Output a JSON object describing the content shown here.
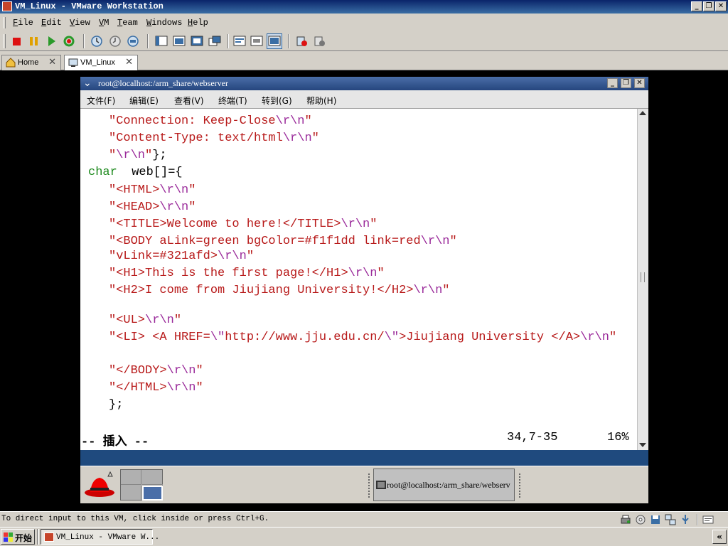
{
  "window": {
    "title": "VM_Linux - VMware Workstation"
  },
  "menu": [
    "File",
    "Edit",
    "View",
    "VM",
    "Team",
    "Windows",
    "Help"
  ],
  "toolbar": {
    "icons": [
      "stop-icon",
      "pause-icon",
      "play-icon",
      "reset-icon",
      "snapshot-icon",
      "revert-snapshot-icon",
      "snapshot-manager-icon",
      "normal-view-icon",
      "quick-switch-icon",
      "full-screen-icon",
      "summary-view-icon",
      "console-view-icon",
      "appliance-view-icon",
      "connect-icon",
      "disconnect-icon"
    ]
  },
  "tabs": [
    {
      "label": "Home",
      "active": false
    },
    {
      "label": "VM_Linux",
      "active": true
    }
  ],
  "guest": {
    "title": "root@localhost:/arm_share/webserver",
    "menu": [
      "文件(F)",
      "编辑(E)",
      "查看(V)",
      "终端(T)",
      "转到(G)",
      "帮助(H)"
    ],
    "mode": "-- 插入 --",
    "position": "34,7-35",
    "percent": "16%",
    "taskbar_item": "root@localhost:/arm_share/webserv"
  },
  "code": [
    {
      "indent": 4,
      "parts": [
        [
          "s",
          "\"Connection: Keep-Close"
        ],
        [
          "e",
          "\\r\\n"
        ],
        [
          "s",
          "\""
        ]
      ]
    },
    {
      "indent": 4,
      "parts": [
        [
          "s",
          "\"Content-Type: text/html"
        ],
        [
          "e",
          "\\r\\n"
        ],
        [
          "s",
          "\""
        ]
      ]
    },
    {
      "indent": 4,
      "parts": [
        [
          "s",
          "\""
        ],
        [
          "e",
          "\\r\\n"
        ],
        [
          "s",
          "\""
        ],
        [
          "p",
          "};"
        ]
      ]
    },
    {
      "indent": 0,
      "parts": [
        [
          "k",
          "char"
        ],
        [
          "p",
          "  web[]={"
        ]
      ]
    },
    {
      "indent": 4,
      "parts": [
        [
          "s",
          "\"<HTML>"
        ],
        [
          "e",
          "\\r\\n"
        ],
        [
          "s",
          "\""
        ]
      ]
    },
    {
      "indent": 4,
      "parts": [
        [
          "s",
          "\"<HEAD>"
        ],
        [
          "e",
          "\\r\\n"
        ],
        [
          "s",
          "\""
        ]
      ]
    },
    {
      "indent": 4,
      "parts": [
        [
          "s",
          "\"<TITLE>Welcome to here!</TITLE>"
        ],
        [
          "e",
          "\\r\\n"
        ],
        [
          "s",
          "\""
        ]
      ]
    },
    {
      "indent": 4,
      "parts": [
        [
          "s",
          "\"<BODY aLink=green bgColor=#f1f1dd link=red"
        ],
        [
          "e",
          "\\r\\n"
        ],
        [
          "s",
          "\""
        ]
      ]
    },
    {
      "indent": 4,
      "parts": [
        [
          "s",
          "\"vLink=#321afd>"
        ],
        [
          "e",
          "\\r\\n"
        ],
        [
          "s",
          "\""
        ]
      ]
    },
    {
      "indent": 4,
      "parts": [
        [
          "s",
          "\"<H1>This is the first page!</H1>"
        ],
        [
          "e",
          "\\r\\n"
        ],
        [
          "s",
          "\""
        ]
      ]
    },
    {
      "indent": 4,
      "parts": [
        [
          "s",
          "\"<H2>I come from Jiujiang University!</H2>"
        ],
        [
          "e",
          "\\r\\n"
        ],
        [
          "s",
          "\""
        ]
      ]
    },
    {
      "indent": 4,
      "parts": []
    },
    {
      "indent": 4,
      "parts": [
        [
          "s",
          "\"<UL>"
        ],
        [
          "e",
          "\\r\\n"
        ],
        [
          "s",
          "\""
        ]
      ]
    },
    {
      "indent": 4,
      "parts": [
        [
          "s",
          "\"<LI> <A HREF="
        ],
        [
          "e",
          "\\\""
        ],
        [
          "s",
          "http://www.jju.edu.cn/"
        ],
        [
          "e",
          "\\\""
        ],
        [
          "s",
          ">Jiujiang University </A>"
        ],
        [
          "e",
          "\\r\\n"
        ],
        [
          "s",
          "\""
        ]
      ]
    },
    {
      "indent": 4,
      "parts": []
    },
    {
      "indent": 4,
      "parts": [
        [
          "s",
          "\"</BODY>"
        ],
        [
          "e",
          "\\r\\n"
        ],
        [
          "s",
          "\""
        ]
      ]
    },
    {
      "indent": 4,
      "parts": [
        [
          "s",
          "\"</HTML>"
        ],
        [
          "e",
          "\\r\\n"
        ],
        [
          "s",
          "\""
        ]
      ]
    },
    {
      "indent": 4,
      "parts": [
        [
          "p",
          "};"
        ]
      ]
    }
  ],
  "status": {
    "text": "To direct input to this VM, click inside or press Ctrl+G."
  },
  "taskbar": {
    "start_label": "开始",
    "item_label": "VM_Linux - VMware W..."
  }
}
